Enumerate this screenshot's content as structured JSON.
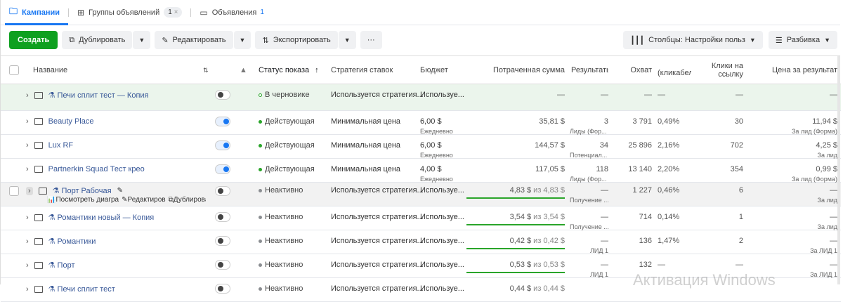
{
  "tabs": [
    {
      "label": "Кампании",
      "icon": "folder-icon"
    },
    {
      "label": "Группы объявлений",
      "icon": "grid-icon",
      "badge": "1",
      "close": "×"
    },
    {
      "label": "Объявления",
      "icon": "window-icon",
      "count": "1"
    }
  ],
  "toolbar": {
    "create": "Создать",
    "duplicate": "Дублировать",
    "edit": "Редактировать",
    "export": "Экспортировать",
    "more": "···",
    "columns": "Столбцы: Настройки польз",
    "breakdown": "Разбивка"
  },
  "headers": {
    "name": "Название",
    "status": "Статус показа",
    "strategy": "Стратегия ставок",
    "budget": "Бюджет",
    "spent": "Потраченная сумма",
    "results": "Результать",
    "reach": "Охват",
    "ctr": "(кликабел",
    "clicks": "Клики на ссылку",
    "cost": "Цена за результат"
  },
  "row_actions": {
    "chart": "Посмотреть диагра",
    "edit": "Редактиров",
    "duplicate": "Дублирова"
  },
  "rows": [
    {
      "name": "Печи сплит тест — Копия",
      "test": true,
      "on": false,
      "status": "В черновике",
      "status_color": "#2aa52a",
      "draft": true,
      "strategy": "Используется стратегия...",
      "budget": "Используе...",
      "spent": "—",
      "results": "—",
      "reach": "—",
      "ctr": "—",
      "clicks": "—",
      "cost": "—"
    },
    {
      "name": "Beauty Place",
      "on": true,
      "status": "Действующая",
      "status_color": "#2aa52a",
      "strategy": "Минимальная цена",
      "budget": "6,00 $",
      "budget_sub": "Ежедневно",
      "spent": "35,81 $",
      "results": "3",
      "results_sub": "Лиды (Фор...",
      "reach": "3 791",
      "ctr": "0,49%",
      "clicks": "30",
      "cost": "11,94 $",
      "cost_sub": "За лид (Форма)"
    },
    {
      "name": "Lux RF",
      "on": true,
      "status": "Действующая",
      "status_color": "#2aa52a",
      "strategy": "Минимальная цена",
      "budget": "6,00 $",
      "budget_sub": "Ежедневно",
      "spent": "144,57 $",
      "results": "34",
      "results_sub": "Потенциал...",
      "reach": "25 896",
      "ctr": "2,16%",
      "clicks": "702",
      "cost": "4,25 $",
      "cost_sub": "За лид"
    },
    {
      "name": "Partnerkin Squad Тест крео",
      "on": true,
      "status": "Действующая",
      "status_color": "#2aa52a",
      "strategy": "Минимальная цена",
      "budget": "4,00 $",
      "budget_sub": "Ежедневно",
      "spent": "117,05 $",
      "results": "118",
      "results_sub": "Лиды (Фор...",
      "reach": "13 140",
      "ctr": "2,20%",
      "clicks": "354",
      "cost": "0,99 $",
      "cost_sub": "За лид (Форма)"
    },
    {
      "name": "Порт Рабочая",
      "test": true,
      "hover": true,
      "on": false,
      "status": "Неактивно",
      "status_color": "#8a8d91",
      "strategy": "Используется стратегия...",
      "budget": "Используе...",
      "spent": "4,83 $",
      "spent_of": "из 4,83 $",
      "progress": 1.0,
      "results": "—",
      "results_sub": "Получение ...",
      "reach": "1 227",
      "ctr": "0,46%",
      "clicks": "6",
      "cost": "—",
      "cost_sub": "За лид"
    },
    {
      "name": "Романтики новый — Копия",
      "test": true,
      "on": false,
      "status": "Неактивно",
      "status_color": "#8a8d91",
      "strategy": "Используется стратегия...",
      "budget": "Используе...",
      "spent": "3,54 $",
      "spent_of": "из 3,54 $",
      "progress": 1.0,
      "results": "—",
      "results_sub": "Получение ...",
      "reach": "714",
      "ctr": "0,14%",
      "clicks": "1",
      "cost": "—",
      "cost_sub": "За лид"
    },
    {
      "name": "Романтики",
      "test": true,
      "on": false,
      "status": "Неактивно",
      "status_color": "#8a8d91",
      "strategy": "Используется стратегия...",
      "budget": "Используе...",
      "spent": "0,42 $",
      "spent_of": "из 0,42 $",
      "progress": 1.0,
      "results": "—",
      "results_sub": "ЛИД 1",
      "reach": "136",
      "ctr": "1,47%",
      "clicks": "2",
      "cost": "—",
      "cost_sub": "За ЛИД 1"
    },
    {
      "name": "Порт",
      "test": true,
      "on": false,
      "status": "Неактивно",
      "status_color": "#8a8d91",
      "strategy": "Используется стратегия...",
      "budget": "Используе...",
      "spent": "0,53 $",
      "spent_of": "из 0,53 $",
      "progress": 1.0,
      "results": "—",
      "results_sub": "ЛИД 1",
      "reach": "132",
      "ctr": "—",
      "clicks": "—",
      "cost": "—",
      "cost_sub": "За ЛИД 1"
    },
    {
      "name": "Печи сплит тест",
      "test": true,
      "on": false,
      "status": "Неактивно",
      "status_color": "#8a8d91",
      "strategy": "Используется стратегия...",
      "budget": "Используе...",
      "spent": "0,44 $",
      "spent_of": "из 0,44 $",
      "progress": 1.0,
      "results": "",
      "reach": "",
      "ctr": "",
      "clicks": "",
      "cost": ""
    }
  ],
  "watermark": "Активация Windows"
}
